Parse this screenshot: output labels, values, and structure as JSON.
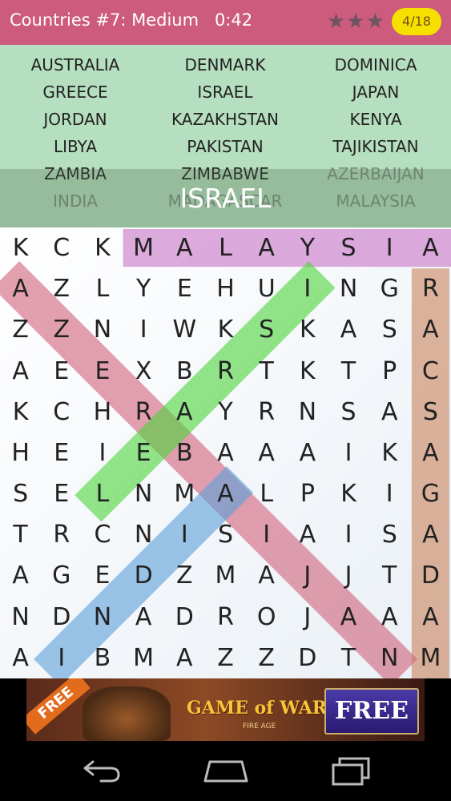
{
  "header": {
    "title": "Countries #7: Medium",
    "timer": "0:42",
    "stars": "★★★",
    "progress": "4/18"
  },
  "word_bank": [
    {
      "text": "AUSTRALIA",
      "found": false
    },
    {
      "text": "DENMARK",
      "found": false
    },
    {
      "text": "DOMINICA",
      "found": false
    },
    {
      "text": "GREECE",
      "found": false
    },
    {
      "text": "ISRAEL",
      "found": false
    },
    {
      "text": "JAPAN",
      "found": false
    },
    {
      "text": "JORDAN",
      "found": false
    },
    {
      "text": "KAZAKHSTAN",
      "found": false
    },
    {
      "text": "KENYA",
      "found": false
    },
    {
      "text": "LIBYA",
      "found": false
    },
    {
      "text": "PAKISTAN",
      "found": false
    },
    {
      "text": "TAJIKISTAN",
      "found": false
    },
    {
      "text": "ZAMBIA",
      "found": false
    },
    {
      "text": "ZIMBABWE",
      "found": false
    },
    {
      "text": "AZERBAIJAN",
      "found": true
    },
    {
      "text": "INDIA",
      "found": true
    },
    {
      "text": "MADAGASCAR",
      "found": true
    },
    {
      "text": "MALAYSIA",
      "found": true
    }
  ],
  "current_word": "ISRAEL",
  "grid": [
    "KCKMALAYSIA",
    "AZLYEHUINGR",
    "ZZNIWKSKASA",
    "AEEXBRTKTPC",
    "KCHRAYRNSAS",
    "HEIEBAAAIKA",
    "SELNMALPKIG",
    "TRCNISIAISA",
    "AGEDZMAJJTD",
    "NDNADROJAAA",
    "AIBMAZZDTNM"
  ],
  "highlights": [
    {
      "word": "MALAYSIA",
      "from": [
        0,
        3
      ],
      "to": [
        0,
        10
      ],
      "color": "#c873c6"
    },
    {
      "word": "MADAGASCAR",
      "from": [
        10,
        10
      ],
      "to": [
        1,
        10
      ],
      "color": "#c9835b"
    },
    {
      "word": "AZERBAIJAN",
      "from": [
        1,
        0
      ],
      "to": [
        10,
        9
      ],
      "color": "#d0607a"
    },
    {
      "word": "INDIA",
      "from": [
        10,
        1
      ],
      "to": [
        6,
        5
      ],
      "color": "#5aa0d8"
    },
    {
      "word": "ISRAEL",
      "from": [
        1,
        7
      ],
      "to": [
        6,
        2
      ],
      "color": "#4cd43a"
    }
  ],
  "ad": {
    "ribbon": "FREE",
    "logo": "GAME of WAR",
    "subtitle": "FIRE AGE",
    "button": "FREE"
  },
  "nav": {
    "back_icon": "back-arrow-icon",
    "home_icon": "home-icon",
    "recents_icon": "recent-apps-icon"
  }
}
